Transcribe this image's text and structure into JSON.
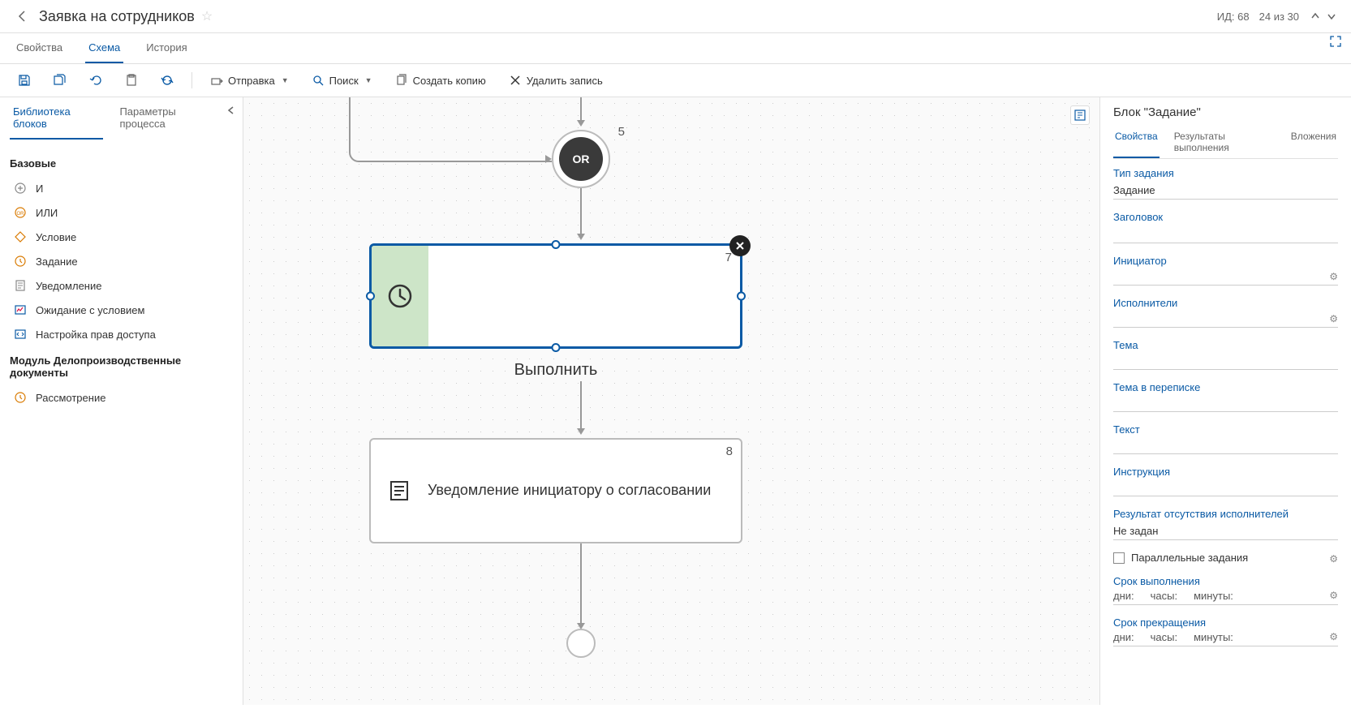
{
  "header": {
    "title": "Заявка на сотрудников",
    "id_label": "ИД: 68",
    "pager": "24 из 30"
  },
  "top_tabs": [
    "Свойства",
    "Схема",
    "История"
  ],
  "top_tabs_active": 1,
  "toolbar": {
    "send": "Отправка",
    "search": "Поиск",
    "copy": "Создать копию",
    "delete": "Удалить запись"
  },
  "left_tabs": [
    "Библиотека блоков",
    "Параметры процесса"
  ],
  "left_tabs_active": 0,
  "block_groups": [
    {
      "title": "Базовые",
      "items": [
        {
          "icon": "plus-circle",
          "label": "И"
        },
        {
          "icon": "or-circle",
          "label": "ИЛИ"
        },
        {
          "icon": "diamond",
          "label": "Условие"
        },
        {
          "icon": "clock",
          "label": "Задание"
        },
        {
          "icon": "doc",
          "label": "Уведомление"
        },
        {
          "icon": "chart",
          "label": "Ожидание с условием"
        },
        {
          "icon": "key",
          "label": "Настройка прав доступа"
        }
      ]
    },
    {
      "title": "Модуль Делопроизводственные документы",
      "items": [
        {
          "icon": "clock",
          "label": "Рассмотрение"
        }
      ]
    }
  ],
  "canvas": {
    "or_node": {
      "label": "OR",
      "num": "5"
    },
    "task_node": {
      "num": "7",
      "action_label": "Выполнить"
    },
    "notif_node": {
      "num": "8",
      "text": "Уведомление инициатору о согласовании"
    }
  },
  "right_panel": {
    "title": "Блок \"Задание\"",
    "tabs": [
      "Свойства",
      "Результаты выполнения",
      "Вложения"
    ],
    "tabs_active": 0,
    "fields": {
      "task_type_label": "Тип задания",
      "task_type_value": "Задание",
      "heading_label": "Заголовок",
      "initiator_label": "Инициатор",
      "performers_label": "Исполнители",
      "subject_label": "Тема",
      "subject_thread_label": "Тема в переписке",
      "text_label": "Текст",
      "instruction_label": "Инструкция",
      "noperf_result_label": "Результат отсутствия исполнителей",
      "noperf_result_value": "Не задан",
      "parallel_label": "Параллельные задания",
      "deadline_label": "Срок выполнения",
      "termination_label": "Срок прекращения",
      "days": "дни:",
      "hours": "часы:",
      "minutes": "минуты:"
    }
  }
}
